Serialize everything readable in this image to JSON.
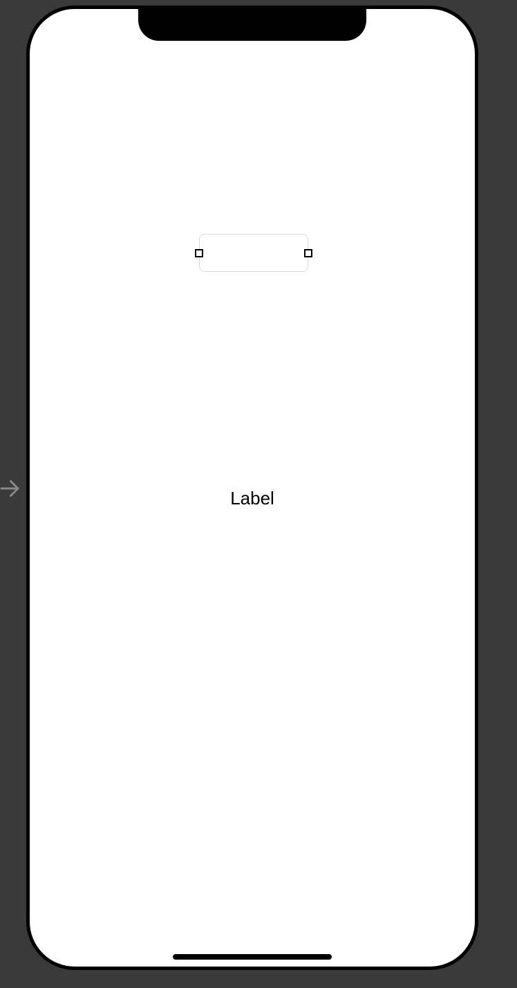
{
  "canvas": {
    "label_text": "Label"
  }
}
